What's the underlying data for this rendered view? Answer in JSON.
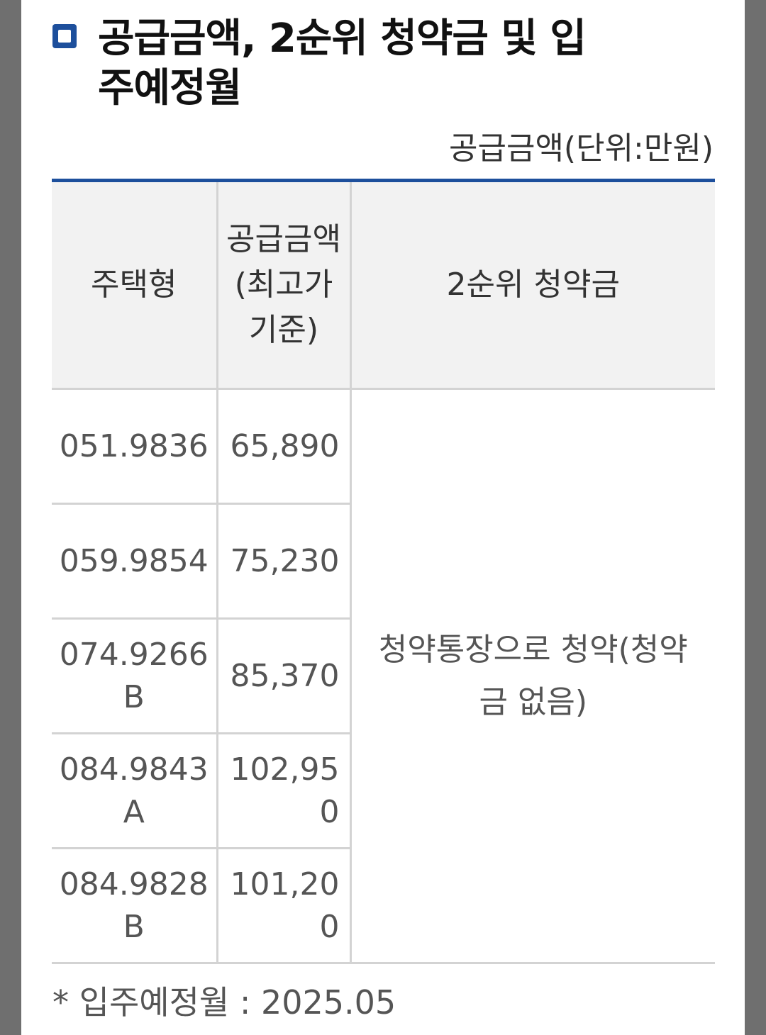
{
  "section": {
    "title": "공급금액, 2순위 청약금 및 입주예정월",
    "unit_note": "공급금액(단위:만원)"
  },
  "table": {
    "headers": [
      "주택형",
      "공급금액(최고가 기준)",
      "2순위 청약금"
    ],
    "rows": [
      {
        "type": "051.9836",
        "amount": "65,890"
      },
      {
        "type": "059.9854",
        "amount": "75,230"
      },
      {
        "type": "074.9266B",
        "amount": "85,370"
      },
      {
        "type": "084.9843A",
        "amount": "102,950"
      },
      {
        "type": "084.9828B",
        "amount": "101,200"
      }
    ],
    "deposit_note": "청약통장으로 청약(청약금 없음)"
  },
  "footer": {
    "move_in": "* 입주예정월 : 2025.05"
  },
  "colors": {
    "accent": "#1d4f9c",
    "header_bg": "#f2f2f2",
    "border": "#d3d3d3",
    "frame": "#6f6f6f"
  }
}
